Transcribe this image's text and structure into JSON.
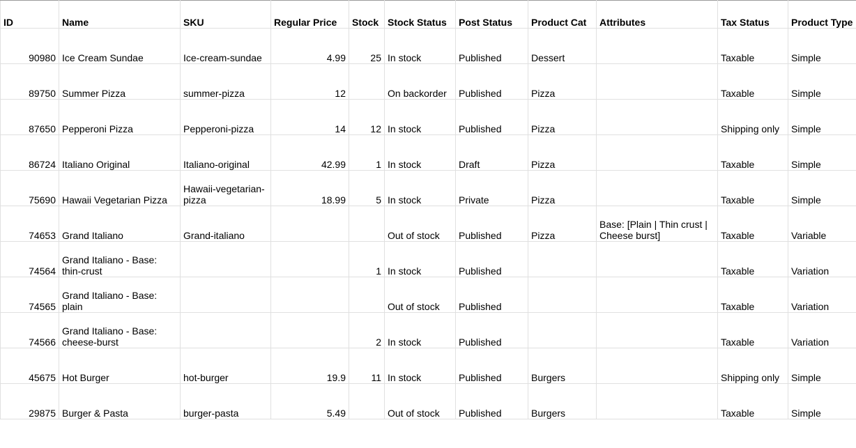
{
  "headers": {
    "id": "ID",
    "name": "Name",
    "sku": "SKU",
    "regular_price": "Regular Price",
    "stock": "Stock",
    "stock_status": "Stock Status",
    "post_status": "Post Status",
    "product_cat": "Product Cat",
    "attributes": "Attributes",
    "tax_status": "Tax Status",
    "product_type": "Product Type"
  },
  "rows": [
    {
      "id": "90980",
      "name": "Ice Cream Sundae",
      "sku": "Ice-cream-sundae",
      "regular_price": "4.99",
      "stock": "25",
      "stock_status": "In stock",
      "post_status": "Published",
      "product_cat": "Dessert",
      "attributes": "",
      "tax_status": "Taxable",
      "product_type": "Simple"
    },
    {
      "id": "89750",
      "name": "Summer Pizza",
      "sku": "summer-pizza",
      "regular_price": "12",
      "stock": "",
      "stock_status": "On backorder",
      "post_status": "Published",
      "product_cat": "Pizza",
      "attributes": "",
      "tax_status": "Taxable",
      "product_type": "Simple"
    },
    {
      "id": "87650",
      "name": "Pepperoni Pizza",
      "sku": "Pepperoni-pizza",
      "regular_price": "14",
      "stock": "12",
      "stock_status": "In stock",
      "post_status": "Published",
      "product_cat": "Pizza",
      "attributes": "",
      "tax_status": "Shipping only",
      "product_type": "Simple"
    },
    {
      "id": "86724",
      "name": "Italiano Original",
      "sku": "Italiano-original",
      "regular_price": "42.99",
      "stock": "1",
      "stock_status": "In stock",
      "post_status": "Draft",
      "product_cat": "Pizza",
      "attributes": "",
      "tax_status": "Taxable",
      "product_type": "Simple"
    },
    {
      "id": "75690",
      "name": "Hawaii Vegetarian Pizza",
      "sku": "Hawaii-vegetarian-pizza",
      "regular_price": "18.99",
      "stock": "5",
      "stock_status": "In stock",
      "post_status": "Private",
      "product_cat": "Pizza",
      "attributes": "",
      "tax_status": "Taxable",
      "product_type": "Simple"
    },
    {
      "id": "74653",
      "name": "Grand Italiano",
      "sku": "Grand-italiano",
      "regular_price": "",
      "stock": "",
      "stock_status": "Out of stock",
      "post_status": "Published",
      "product_cat": "Pizza",
      "attributes": "Base: [Plain | Thin crust | Cheese burst]",
      "tax_status": "Taxable",
      "product_type": "Variable"
    },
    {
      "id": "74564",
      "name": "Grand Italiano - Base: thin-crust",
      "sku": "",
      "regular_price": "",
      "stock": "1",
      "stock_status": "In stock",
      "post_status": "Published",
      "product_cat": "",
      "attributes": "",
      "tax_status": "Taxable",
      "product_type": "Variation"
    },
    {
      "id": "74565",
      "name": "Grand Italiano - Base: plain",
      "sku": "",
      "regular_price": "",
      "stock": "",
      "stock_status": "Out of stock",
      "post_status": "Published",
      "product_cat": "",
      "attributes": "",
      "tax_status": "Taxable",
      "product_type": "Variation"
    },
    {
      "id": "74566",
      "name": "Grand Italiano - Base: cheese-burst",
      "sku": "",
      "regular_price": "",
      "stock": "2",
      "stock_status": "In stock",
      "post_status": "Published",
      "product_cat": "",
      "attributes": "",
      "tax_status": "Taxable",
      "product_type": "Variation"
    },
    {
      "id": "45675",
      "name": "Hot Burger",
      "sku": "hot-burger",
      "regular_price": "19.9",
      "stock": "11",
      "stock_status": "In stock",
      "post_status": "Published",
      "product_cat": "Burgers",
      "attributes": "",
      "tax_status": "Shipping only",
      "product_type": "Simple"
    },
    {
      "id": "29875",
      "name": "Burger & Pasta",
      "sku": "burger-pasta",
      "regular_price": "5.49",
      "stock": "",
      "stock_status": "Out of stock",
      "post_status": "Published",
      "product_cat": "Burgers",
      "attributes": "",
      "tax_status": "Taxable",
      "product_type": "Simple"
    }
  ]
}
